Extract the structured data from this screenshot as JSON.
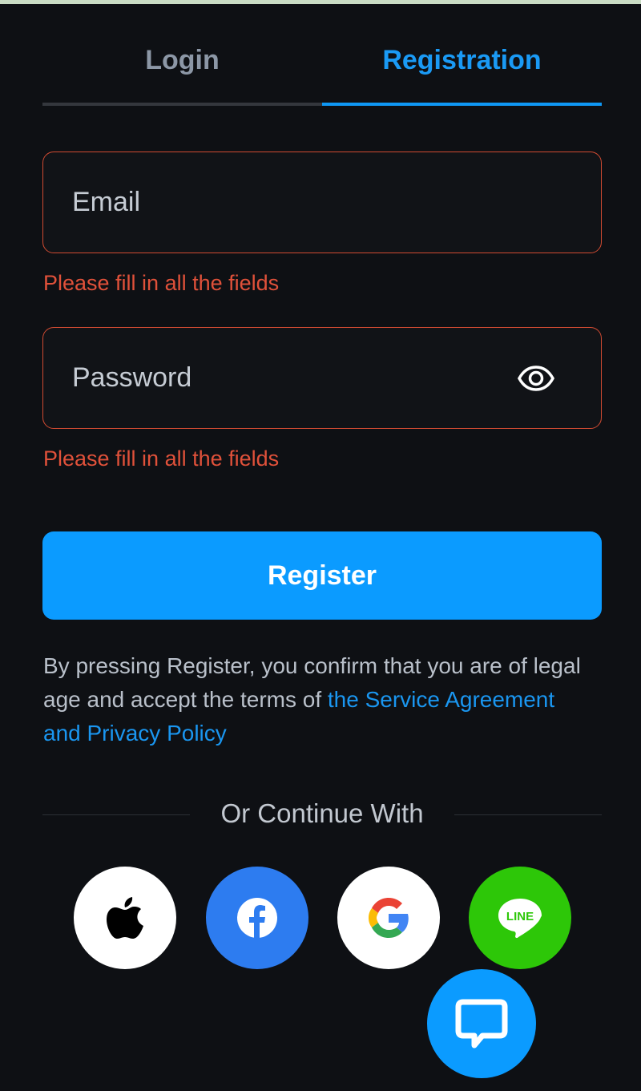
{
  "tabs": {
    "login_label": "Login",
    "registration_label": "Registration",
    "active": "Registration"
  },
  "form": {
    "email": {
      "placeholder": "Email",
      "value": "",
      "error": "Please fill in all the fields"
    },
    "password": {
      "placeholder": "Password",
      "value": "",
      "error": "Please fill in all the fields",
      "toggle_icon": "eye-icon"
    },
    "register_label": "Register"
  },
  "terms": {
    "text": "By pressing Register, you confirm that you are of legal age and accept the terms of ",
    "link_text": "the Service Agreement and Privacy Policy"
  },
  "social": {
    "divider_text": "Or Continue With",
    "providers": [
      {
        "icon": "apple-icon",
        "color": "#ffffff"
      },
      {
        "icon": "facebook-icon",
        "color": "#2d7cf0"
      },
      {
        "icon": "google-icon",
        "color": "#ffffff"
      },
      {
        "icon": "line-icon",
        "color": "#2dc708",
        "label": "LINE"
      }
    ]
  },
  "chat": {
    "icon": "chat-bubble-icon"
  },
  "colors": {
    "accent": "#0b9bff",
    "error": "#e0513a",
    "background": "#0e1014"
  }
}
